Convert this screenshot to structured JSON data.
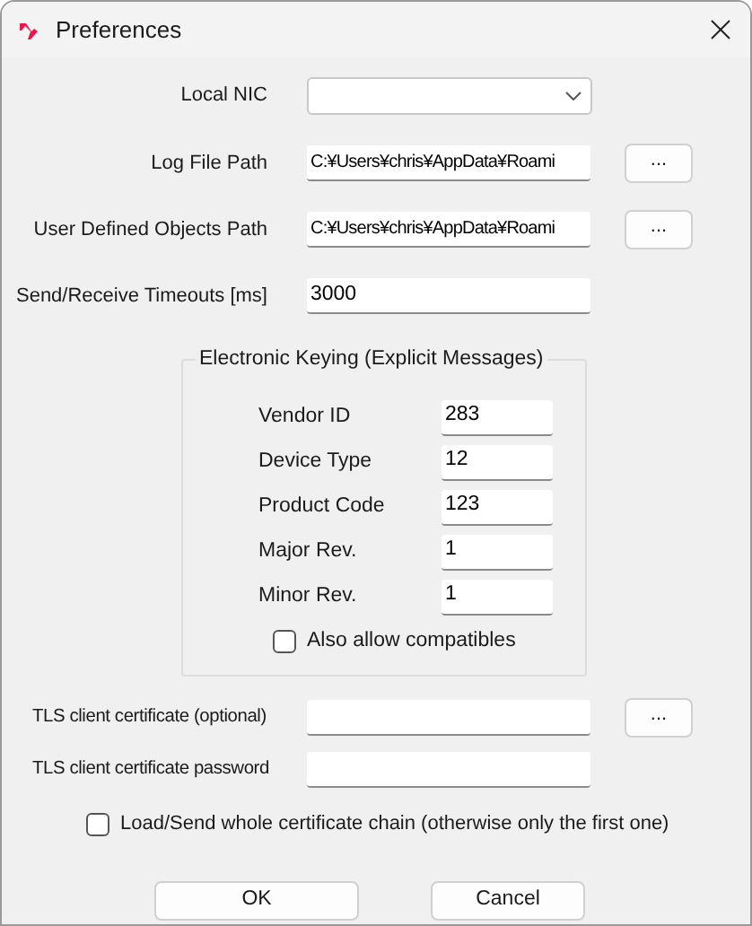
{
  "window": {
    "title": "Preferences"
  },
  "fields": [
    {
      "kind": "dropdown",
      "label": "Local NIC"
    },
    {
      "kind": "path",
      "label": "Log File Path",
      "value": "C:¥Users¥chris¥AppData¥Roami",
      "browse": "..."
    },
    {
      "kind": "path",
      "label": "User Defined Objects Path",
      "value": "C:¥Users¥chris¥AppData¥Roami",
      "browse": "..."
    },
    {
      "kind": "text",
      "label": "Send/Receive Timeouts [ms]",
      "value": "3000"
    }
  ],
  "keying": {
    "title": "Electronic Keying (Explicit Messages)",
    "fields": [
      {
        "label": "Vendor ID",
        "value": "283"
      },
      {
        "label": "Device Type",
        "value": "12"
      },
      {
        "label": "Product Code",
        "value": "123"
      },
      {
        "label": "Major Rev.",
        "value": "1"
      },
      {
        "label": "Minor Rev.",
        "value": "1"
      }
    ],
    "checkbox": {
      "label": "Also allow compatibles",
      "checked": false
    }
  },
  "tls": [
    {
      "label": "TLS client certificate (optional)",
      "browse": "..."
    },
    {
      "label": "TLS client certificate password"
    }
  ],
  "chain": {
    "label": "Load/Send whole certificate chain (otherwise only the first one)",
    "checked": false
  },
  "buttons": [
    "OK",
    "Cancel"
  ]
}
